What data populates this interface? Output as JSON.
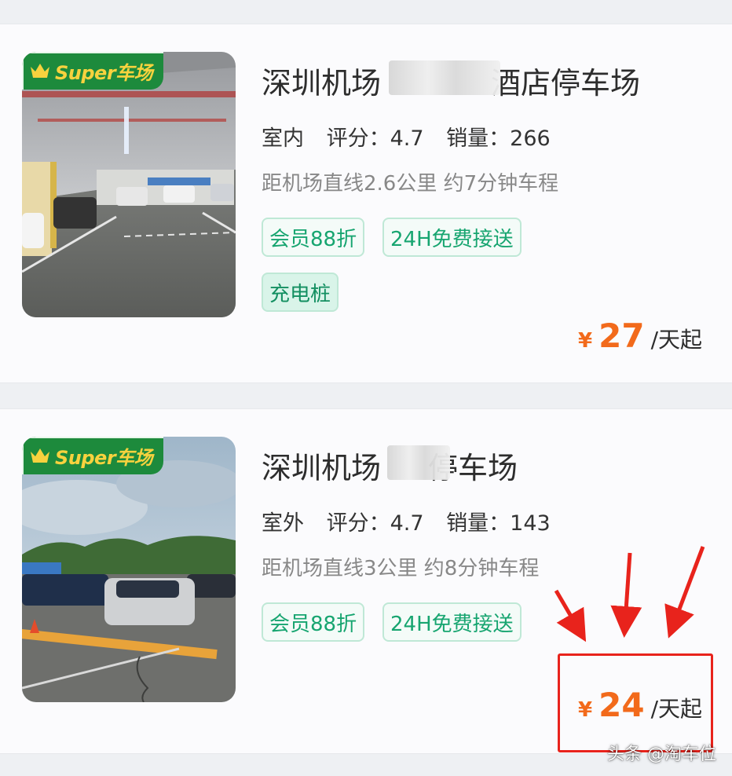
{
  "listings": [
    {
      "badge": "Super车场",
      "title_start": "深圳机场",
      "title_end": "酒店停车场",
      "type": "室内",
      "rating": "评分：4.7",
      "sales": "销量：266",
      "distance": "距机场直线2.6公里 约7分钟车程",
      "tags": [
        "会员88折",
        "24H免费接送",
        "充电桩"
      ],
      "price_symbol": "¥",
      "price": "27",
      "price_unit": "/天起"
    },
    {
      "badge": "Super车场",
      "title_start": "深圳机场",
      "title_end": "停车场",
      "type": "室外",
      "rating": "评分：4.7",
      "sales": "销量：143",
      "distance": "距机场直线3公里 约8分钟车程",
      "tags": [
        "会员88折",
        "24H免费接送"
      ],
      "price_symbol": "¥",
      "price": "24",
      "price_unit": "/天起"
    }
  ],
  "watermark": "头条 @淘车位",
  "colors": {
    "accent_green": "#17a570",
    "badge_green": "#1d8a3c",
    "badge_text": "#f7d23e",
    "price_orange": "#f26a1b",
    "annotation_red": "#e8231c"
  },
  "icons": {
    "badge_icon": "crown-icon",
    "annotation": "red-arrow-icons"
  }
}
